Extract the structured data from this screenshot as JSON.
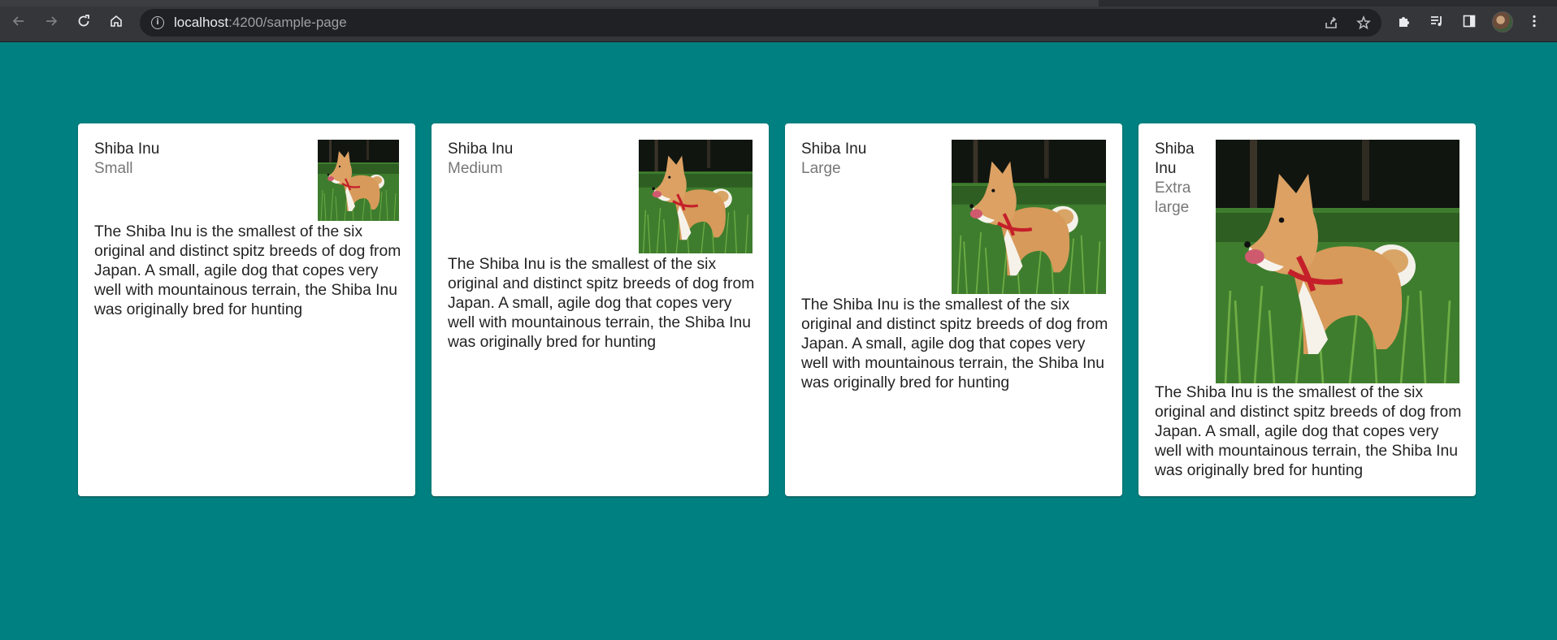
{
  "browser": {
    "url_host": "localhost",
    "url_path": ":4200/sample-page",
    "icons": {
      "back": "arrow-left-icon",
      "forward": "arrow-right-icon",
      "reload": "reload-icon",
      "home": "home-icon",
      "site_info": "info-icon",
      "share": "share-icon",
      "bookmark": "star-icon",
      "extensions": "puzzle-icon",
      "media": "media-queue-icon",
      "side_panel": "side-panel-icon",
      "menu": "kebab-menu-icon"
    }
  },
  "colors": {
    "page_background": "#008080",
    "card_background": "#ffffff"
  },
  "cards": [
    {
      "title": "Shiba Inu",
      "subtitle": "Small",
      "content": "The Shiba Inu is the smallest of the six original and distinct spitz breeds of dog from Japan. A small, agile dog that copes very well with mountainous terrain, the Shiba Inu was originally bred for hunting"
    },
    {
      "title": "Shiba Inu",
      "subtitle": "Medium",
      "content": "The Shiba Inu is the smallest of the six original and distinct spitz breeds of dog from Japan. A small, agile dog that copes very well with mountainous terrain, the Shiba Inu was originally bred for hunting"
    },
    {
      "title": "Shiba Inu",
      "subtitle": "Large",
      "content": "The Shiba Inu is the smallest of the six original and distinct spitz breeds of dog from Japan. A small, agile dog that copes very well with mountainous terrain, the Shiba Inu was originally bred for hunting"
    },
    {
      "title": "Shiba Inu",
      "subtitle": "Extra large",
      "content": "The Shiba Inu is the smallest of the six original and distinct spitz breeds of dog from Japan. A small, agile dog that copes very well with mountainous terrain, the Shiba Inu was originally bred for hunting"
    }
  ]
}
